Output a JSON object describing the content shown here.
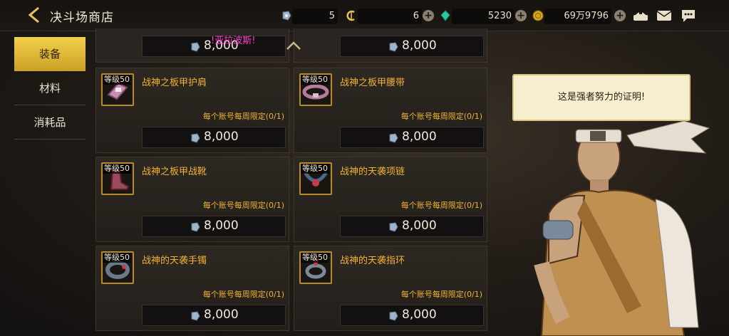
{
  "topbar": {
    "title": "决斗场商店",
    "resources": [
      {
        "name": "ticket",
        "value": "5"
      },
      {
        "name": "coin",
        "value": "6"
      },
      {
        "name": "gem",
        "value": "5230"
      },
      {
        "name": "gold",
        "value": "69万9796"
      }
    ]
  },
  "sidebar": {
    "tabs": [
      {
        "label": "装备",
        "active": true
      },
      {
        "label": "材料",
        "active": false
      },
      {
        "label": "消耗品",
        "active": false
      }
    ]
  },
  "marquee": "!亚拉波斯!",
  "partial_row": [
    {
      "price": "8,000"
    },
    {
      "price": "8,000"
    }
  ],
  "items": [
    {
      "level": "等级50",
      "name": "战神之板甲护肩",
      "limit_prefix": "每个账号每周限定(",
      "count": "0/1",
      "limit_suffix": ")",
      "price": "8,000",
      "icon": "shoulder-armor-icon"
    },
    {
      "level": "等级50",
      "name": "战神之板甲腰带",
      "limit_prefix": "每个账号每周限定(",
      "count": "0/1",
      "limit_suffix": ")",
      "price": "8,000",
      "icon": "belt-icon"
    },
    {
      "level": "等级50",
      "name": "战神之板甲战靴",
      "limit_prefix": "每个账号每周限定(",
      "count": "0/1",
      "limit_suffix": ")",
      "price": "8,000",
      "icon": "boots-icon"
    },
    {
      "level": "等级50",
      "name": "战神的天袭项链",
      "limit_prefix": "每个账号每周限定(",
      "count": "0/1",
      "limit_suffix": ")",
      "price": "8,000",
      "icon": "necklace-icon"
    },
    {
      "level": "等级50",
      "name": "战神的天袭手镯",
      "limit_prefix": "每个账号每周限定(",
      "count": "0/1",
      "limit_suffix": ")",
      "price": "8,000",
      "icon": "bracelet-icon"
    },
    {
      "level": "等级50",
      "name": "战神的天袭指环",
      "limit_prefix": "每个账号每周限定(",
      "count": "0/1",
      "limit_suffix": ")",
      "price": "8,000",
      "icon": "ring-icon"
    }
  ],
  "npc": {
    "speech": "这是强者努力的证明!"
  },
  "colors": {
    "accent_gold": "#f2b236",
    "tab_active": "#e6bd3a",
    "marquee": "#ff3fd0"
  }
}
